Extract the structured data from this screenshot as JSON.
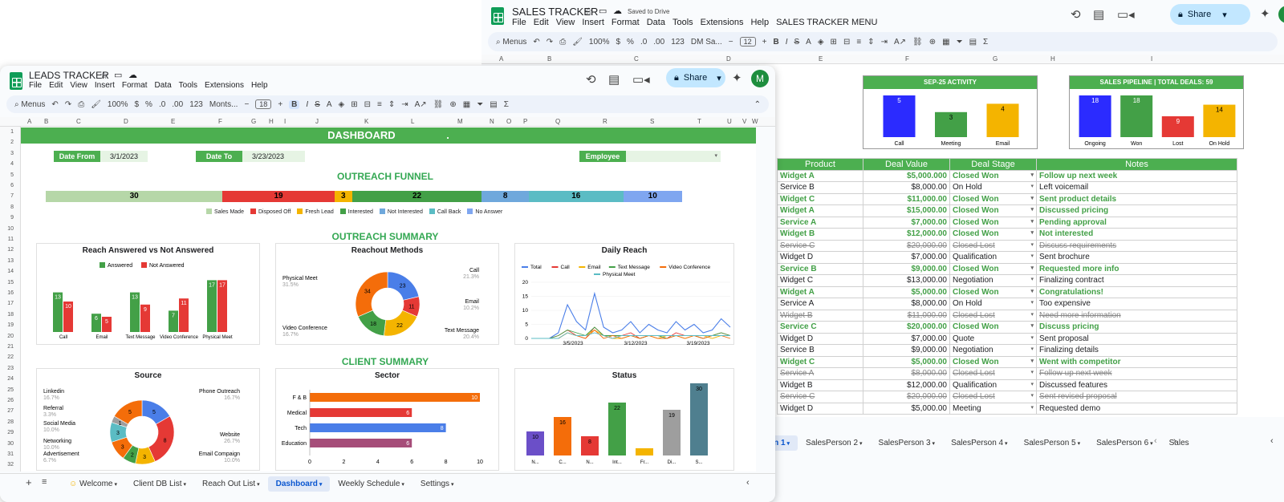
{
  "sales_tracker": {
    "title": "SALES TRACKER",
    "saved": "Saved to Drive",
    "menus": [
      "File",
      "Edit",
      "View",
      "Insert",
      "Format",
      "Data",
      "Tools",
      "Extensions",
      "Help",
      "SALES TRACKER MENU"
    ],
    "toolbar": {
      "menus": "Menus",
      "zoom": "100%",
      "dollar": "$",
      "percent": "%",
      "num": "123",
      "font": "DM Sa...",
      "size": "12"
    },
    "share": "Share",
    "avatar": "M",
    "columns": [
      "A",
      "B",
      "C",
      "D",
      "E",
      "F",
      "G",
      "H",
      "I"
    ],
    "activity": {
      "title": "SEP-25 ACTIVITY",
      "bars": [
        {
          "label": "Call",
          "value": 5,
          "color": "#2b2bff"
        },
        {
          "label": "Meeting",
          "value": 3,
          "color": "#43a047"
        },
        {
          "label": "Email",
          "value": 4,
          "color": "#f4b400"
        }
      ]
    },
    "pipeline": {
      "title": "SALES PIPELINE  |  TOTAL DEALS:  59",
      "bars": [
        {
          "label": "Ongoing",
          "value": 18,
          "color": "#2b2bff"
        },
        {
          "label": "Won",
          "value": 18,
          "color": "#43a047"
        },
        {
          "label": "Lost",
          "value": 9,
          "color": "#e53935"
        },
        {
          "label": "On Hold",
          "value": 14,
          "color": "#f4b400"
        }
      ]
    },
    "table_headers": [
      "Product",
      "Deal Value",
      "Deal Stage",
      "Notes"
    ],
    "rows": [
      {
        "product": "Widget A",
        "value": "$5,000.000",
        "stage": "Closed Won",
        "notes": "Follow up next week",
        "status": "won"
      },
      {
        "product": "Service B",
        "value": "$8,000.00",
        "stage": "On Hold",
        "notes": "Left voicemail",
        "status": ""
      },
      {
        "product": "Widget C",
        "value": "$11,000.00",
        "stage": "Closed Won",
        "notes": "Sent product details",
        "status": "won"
      },
      {
        "product": "Widget A",
        "value": "$15,000.00",
        "stage": "Closed Won",
        "notes": "Discussed pricing",
        "status": "won"
      },
      {
        "product": "Service A",
        "value": "$7,000.00",
        "stage": "Closed Won",
        "notes": "Pending approval",
        "status": "won"
      },
      {
        "product": "Widget B",
        "value": "$12,000.00",
        "stage": "Closed Won",
        "notes": "Not interested",
        "status": "won"
      },
      {
        "product": "Service C",
        "value": "$20,000.00",
        "stage": "Closed Lost",
        "notes": "Discuss requirements",
        "status": "lost"
      },
      {
        "product": "Widget D",
        "value": "$7,000.00",
        "stage": "Qualification",
        "notes": "Sent brochure",
        "status": ""
      },
      {
        "product": "Service B",
        "value": "$9,000.00",
        "stage": "Closed Won",
        "notes": "Requested more info",
        "status": "won"
      },
      {
        "product": "Widget C",
        "value": "$13,000.00",
        "stage": "Negotiation",
        "notes": "Finalizing contract",
        "status": ""
      },
      {
        "product": "Widget A",
        "value": "$5,000.00",
        "stage": "Closed Won",
        "notes": "Congratulations!",
        "status": "won"
      },
      {
        "product": "Service A",
        "value": "$8,000.00",
        "stage": "On Hold",
        "notes": "Too expensive",
        "status": ""
      },
      {
        "product": "Widget B",
        "value": "$11,000.00",
        "stage": "Closed Lost",
        "notes": "Need more information",
        "status": "lost"
      },
      {
        "product": "Service C",
        "value": "$20,000.00",
        "stage": "Closed Won",
        "notes": "Discuss pricing",
        "status": "won"
      },
      {
        "product": "Widget D",
        "value": "$7,000.00",
        "stage": "Quote",
        "notes": "Sent proposal",
        "status": ""
      },
      {
        "product": "Service B",
        "value": "$9,000.00",
        "stage": "Negotiation",
        "notes": "Finalizing details",
        "status": ""
      },
      {
        "product": "Widget C",
        "value": "$5,000.00",
        "stage": "Closed Won",
        "notes": "Went with competitor",
        "status": "won"
      },
      {
        "product": "Service A",
        "value": "$8,000.00",
        "stage": "Closed Lost",
        "notes": "Follow up next week",
        "status": "lost"
      },
      {
        "product": "Widget B",
        "value": "$12,000.00",
        "stage": "Qualification",
        "notes": "Discussed features",
        "status": ""
      },
      {
        "product": "Service C",
        "value": "$20,000.00",
        "stage": "Closed Lost",
        "notes": "Sent revised proposal",
        "status": "lost"
      },
      {
        "product": "Widget D",
        "value": "$5,000.00",
        "stage": "Meeting",
        "notes": "Requested demo",
        "status": ""
      }
    ],
    "tabs": [
      "on 1",
      "SalesPerson 2",
      "SalesPerson 3",
      "SalesPerson 4",
      "SalesPerson 5",
      "SalesPerson 6",
      "Sales"
    ]
  },
  "leads_tracker": {
    "title": "LEADS TRACKER",
    "menus": [
      "File",
      "Edit",
      "View",
      "Insert",
      "Format",
      "Data",
      "Tools",
      "Extensions",
      "Help"
    ],
    "toolbar": {
      "menus": "Menus",
      "zoom": "100%",
      "dollar": "$",
      "percent": "%",
      "num": "123",
      "font": "Monts...",
      "size": "18"
    },
    "share": "Share",
    "avatar": "M",
    "columns": [
      "A",
      "B",
      "C",
      "D",
      "E",
      "F",
      "G",
      "H",
      "I",
      "J",
      "K",
      "L",
      "M",
      "N",
      "O",
      "P",
      "Q",
      "R",
      "S",
      "T",
      "U",
      "V",
      "W"
    ],
    "rows": [
      "1",
      "2",
      "3",
      "4",
      "5",
      "6",
      "7",
      "8",
      "9",
      "10",
      "11",
      "12",
      "13",
      "14",
      "15",
      "16",
      "17",
      "18",
      "19",
      "20",
      "21",
      "22",
      "23",
      "24",
      "25",
      "26",
      "27",
      "28",
      "29",
      "30",
      "31",
      "32"
    ],
    "dashboard": {
      "title": "DASHBOARD",
      "dot": ".",
      "date_from_label": "Date From",
      "date_from": "3/1/2023",
      "date_to_label": "Date To",
      "date_to": "3/23/2023",
      "employee_label": "Employee",
      "outreach_funnel": "OUTREACH FUNNEL",
      "outreach_summary": "OUTREACH SUMMARY",
      "client_summary": "CLIENT SUMMARY"
    },
    "funnel": [
      {
        "name": "Sales Made",
        "value": 30,
        "color": "#b6d7a8"
      },
      {
        "name": "Disposed Off",
        "value": 19,
        "color": "#e53935"
      },
      {
        "name": "Fresh Lead",
        "value": 3,
        "color": "#f4b400"
      },
      {
        "name": "Interested",
        "value": 22,
        "color": "#43a047"
      },
      {
        "name": "Not Interested",
        "value": 8,
        "color": "#6fa8dc"
      },
      {
        "name": "Call Back",
        "value": 16,
        "color": "#5bbcc4"
      },
      {
        "name": "No Answer",
        "value": 10,
        "color": "#7fa6f0"
      }
    ],
    "tabs": [
      "Welcome",
      "Client DB List",
      "Reach Out List",
      "Dashboard",
      "Weekly Schedule",
      "Settings"
    ]
  },
  "chart_data": [
    {
      "type": "bar",
      "title": "Reach Answered vs Not Answered",
      "categories": [
        "Call",
        "Email",
        "Text Message",
        "Video Conference",
        "Physical Meet"
      ],
      "series": [
        {
          "name": "Answered",
          "values": [
            13,
            6,
            13,
            7,
            17
          ],
          "color": "#43a047"
        },
        {
          "name": "Not Answered",
          "values": [
            10,
            5,
            9,
            11,
            17
          ],
          "color": "#e53935"
        }
      ]
    },
    {
      "type": "pie",
      "title": "Reachout Methods",
      "slices": [
        {
          "label": "Call",
          "value": 23,
          "pct": "21.3%",
          "color": "#4a7ee8"
        },
        {
          "label": "Email",
          "value": 11,
          "pct": "10.2%",
          "color": "#e53935"
        },
        {
          "label": "Text Message",
          "value": 22,
          "pct": "20.4%",
          "color": "#f4b400"
        },
        {
          "label": "Video Conference",
          "value": 18,
          "pct": "16.7%",
          "color": "#43a047"
        },
        {
          "label": "Physical Meet",
          "value": 34,
          "pct": "31.5%",
          "color": "#f46d0a"
        }
      ]
    },
    {
      "type": "line",
      "title": "Daily Reach",
      "series_names": [
        "Total",
        "Call",
        "Email",
        "Text Message",
        "Video Conference",
        "Physical Meet"
      ],
      "colors": [
        "#4a7ee8",
        "#e53935",
        "#f4b400",
        "#43a047",
        "#f46d0a",
        "#5bbcc4"
      ],
      "x_ticks": [
        "3/5/2023",
        "3/12/2023",
        "3/19/2023"
      ],
      "ylim": [
        0,
        20
      ],
      "y_ticks": [
        "0",
        "5",
        "10",
        "15",
        "20"
      ]
    },
    {
      "type": "pie",
      "title": "Source",
      "slices": [
        {
          "label": "Phone Outreach",
          "value": 5,
          "pct": "16.7%",
          "color": "#4a7ee8"
        },
        {
          "label": "Website",
          "value": 8,
          "pct": "26.7%",
          "color": "#e53935"
        },
        {
          "label": "Email Compaign",
          "value": 3,
          "pct": "10.0%",
          "color": "#f4b400"
        },
        {
          "label": "Advertisement",
          "value": 2,
          "pct": "6.7%",
          "color": "#43a047"
        },
        {
          "label": "Networking",
          "value": 3,
          "pct": "10.0%",
          "color": "#f46d0a"
        },
        {
          "label": "Social Media",
          "value": 3,
          "pct": "10.0%",
          "color": "#5bbcc4"
        },
        {
          "label": "Referral",
          "value": 1,
          "pct": "3.3%",
          "color": "#9e9e9e"
        },
        {
          "label": "Linkedin",
          "value": 5,
          "pct": "16.7%",
          "color": "#f46d0a"
        }
      ]
    },
    {
      "type": "bar",
      "title": "Sector",
      "orientation": "horizontal",
      "categories": [
        "F & B",
        "Medical",
        "Tech",
        "Education"
      ],
      "values": [
        10,
        6,
        8,
        6
      ],
      "colors": [
        "#f46d0a",
        "#e53935",
        "#4a7ee8",
        "#a64d79"
      ],
      "x_ticks": [
        "0",
        "2",
        "4",
        "6",
        "8",
        "10"
      ]
    },
    {
      "type": "bar",
      "title": "Status",
      "categories": [
        "N...",
        "C...",
        "N...",
        "Int...",
        "Fr...",
        "Di...",
        "S..."
      ],
      "values": [
        10,
        16,
        8,
        22,
        3,
        19,
        30
      ],
      "colors": [
        "#6b4fc8",
        "#f46d0a",
        "#e53935",
        "#43a047",
        "#f4b400",
        "#9e9e9e",
        "#4f7f8f"
      ]
    }
  ]
}
